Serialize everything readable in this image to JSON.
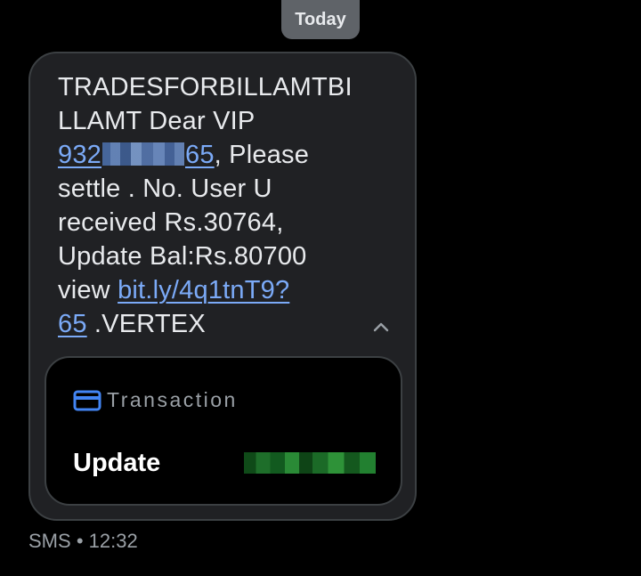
{
  "date_chip": "Today",
  "message": {
    "line1": "TRADESFORBILLAMTBI",
    "line2": "LLAMT Dear VIP",
    "phone_prefix": "932",
    "phone_suffix": "65",
    "line3_rest": ", Please",
    "line4": "settle . No. User U",
    "line5": "received Rs.30764,",
    "line6": "Update Bal:Rs.80700",
    "line7_prefix": "view ",
    "link_part1": "bit.ly/4q1tnT9?",
    "link_part2": "65",
    "line8_rest": " .VERTEX"
  },
  "card": {
    "icon": "credit-card-icon",
    "title": "Transaction",
    "row_label": "Update"
  },
  "meta": {
    "sender_type": "SMS",
    "separator": "•",
    "time": "12:32"
  },
  "colors": {
    "background": "#000000",
    "bubble": "#202124",
    "text": "#e8eaed",
    "link": "#7baaf7",
    "accent_icon": "#4285f4",
    "muted": "#9aa0a6"
  }
}
